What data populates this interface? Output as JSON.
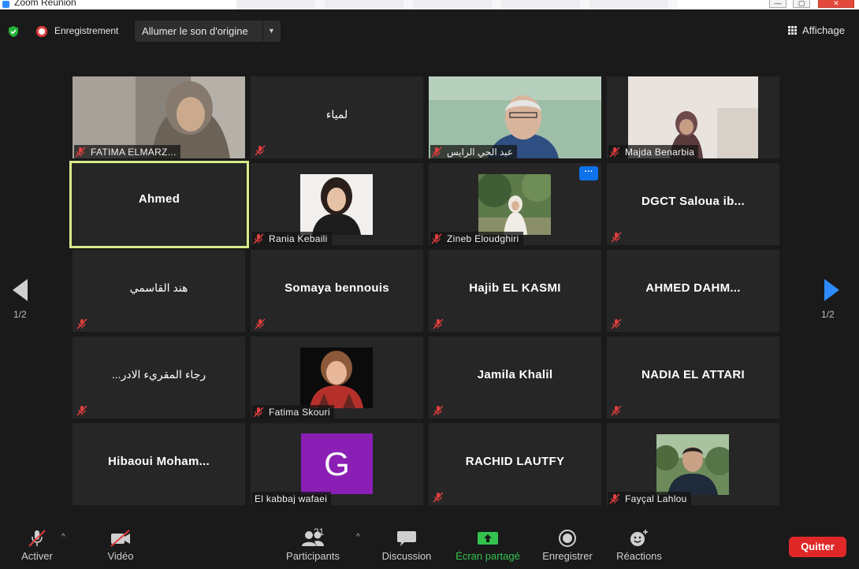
{
  "window": {
    "title": "Zoom Réunion",
    "minimize": "—",
    "maximize": "▢",
    "close": "✕"
  },
  "topbar": {
    "recording_label": "Enregistrement",
    "original_sound_button": "Allumer le son d'origine",
    "view_button": "Affichage"
  },
  "pager": {
    "left": "1/2",
    "right": "1/2"
  },
  "participants": [
    {
      "name": "FATIMA ELMARZ...",
      "video": true,
      "muted": true
    },
    {
      "name": "لمياء",
      "video": false,
      "muted": true
    },
    {
      "name": "عبد الحي الرايس",
      "video": true,
      "muted": true
    },
    {
      "name": "Majda Benarbia",
      "video": true,
      "muted": true
    },
    {
      "name": "Ahmed",
      "video": false,
      "muted": false,
      "active_speaker": true
    },
    {
      "name": "Rania Kebaili",
      "video": true,
      "muted": true
    },
    {
      "name": "Zineb Eloudghiri",
      "video": true,
      "muted": true,
      "more_menu": "···"
    },
    {
      "name": "DGCT  Saloua  ib...",
      "video": false,
      "muted": true
    },
    {
      "name": "هند القاسمي",
      "video": false,
      "muted": true
    },
    {
      "name": "Somaya bennouis",
      "video": false,
      "muted": true
    },
    {
      "name": "Hajib EL KASMI",
      "video": false,
      "muted": true
    },
    {
      "name": "AHMED  DAHM...",
      "video": false,
      "muted": true
    },
    {
      "name": "...رجاء المقري‌ء الادر",
      "video": false,
      "muted": true
    },
    {
      "name": "Fatima Skouri",
      "video": true,
      "muted": true
    },
    {
      "name": "Jamila Khalil",
      "video": false,
      "muted": true
    },
    {
      "name": "NADIA EL ATTARI",
      "video": false,
      "muted": true
    },
    {
      "name": "Hibaoui  Moham...",
      "video": false,
      "muted": true
    },
    {
      "name": "El kabbaj wafaei",
      "video": false,
      "avatar_letter": "G",
      "avatar_color": "#8b1fb5",
      "muted": false
    },
    {
      "name": "RACHID LAUTFY",
      "video": false,
      "muted": true
    },
    {
      "name": "Fayçal Lahlou",
      "video": true,
      "muted": true
    }
  ],
  "toolbar": {
    "unmute": "Activer",
    "video": "Vidéo",
    "participants": "Participants",
    "participants_count": "21",
    "chat": "Discussion",
    "share": "Écran partagé",
    "record": "Enregistrer",
    "reactions": "Réactions",
    "leave": "Quitter"
  },
  "colors": {
    "accent_blue": "#2d8cff",
    "active_border": "#d6ec8a",
    "share_green": "#33c24d",
    "leave_red": "#e02828",
    "mute_red": "#e03e3e"
  }
}
